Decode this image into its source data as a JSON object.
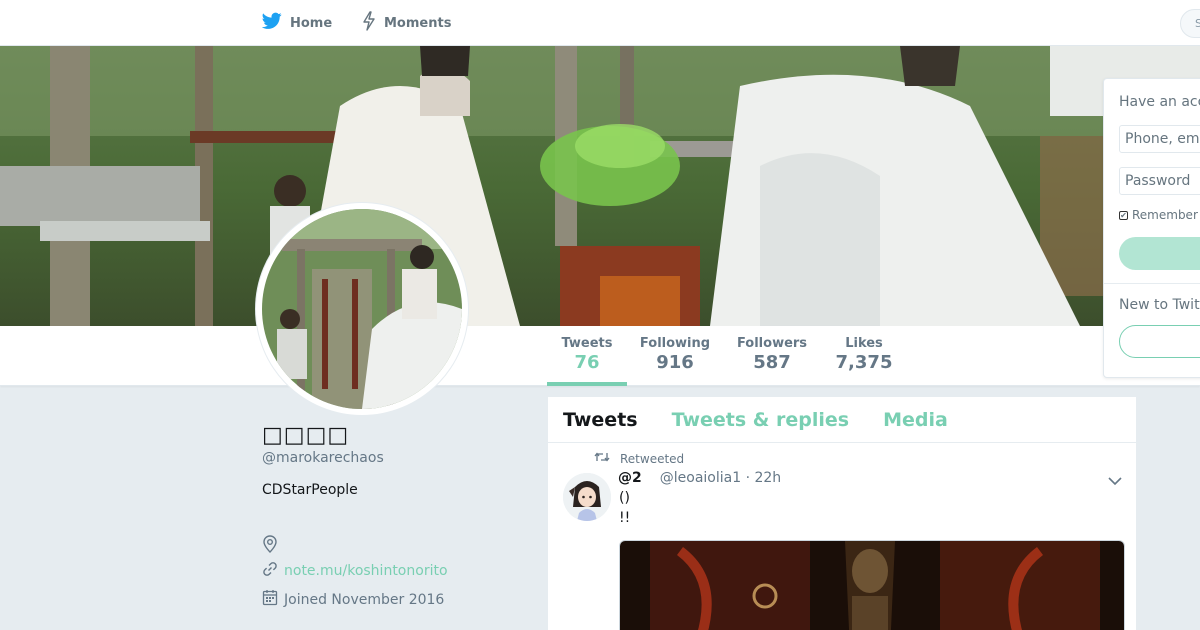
{
  "nav": {
    "home_label": "Home",
    "moments_label": "Moments",
    "search_placeholder": "S"
  },
  "profile": {
    "name": "□□□□",
    "handle": "@marokarechaos",
    "bio": "CDStarPeople",
    "link": "note.mu/koshintonorito",
    "joined": "Joined November 2016"
  },
  "stats": [
    {
      "label": "Tweets",
      "value": "76"
    },
    {
      "label": "Following",
      "value": "916"
    },
    {
      "label": "Followers",
      "value": "587"
    },
    {
      "label": "Likes",
      "value": "7,375"
    }
  ],
  "timeline": {
    "tabs": [
      "Tweets",
      "Tweets & replies",
      "Media"
    ],
    "tweet": {
      "context": "Retweeted",
      "display_name": "@2",
      "handle_time": "@leoaiolia1 · 22h",
      "line1": "()",
      "line2": "!!"
    }
  },
  "login": {
    "title": "Have an account?",
    "phone_placeholder": "Phone, email or username",
    "password_placeholder": "Password",
    "remember_label": "Remember me",
    "new_title": "New to Twitter?"
  },
  "colors": {
    "accent": "#79cfb2",
    "accent_light": "#b2e5d3",
    "page_bg": "#e6ecf0",
    "muted_text": "#657786"
  },
  "icons": {
    "logo": "bird-icon",
    "moments": "lightning-icon",
    "location": "location-pin-icon",
    "link": "link-icon",
    "calendar": "calendar-icon",
    "retweet": "retweet-icon",
    "caret": "chevron-down-icon"
  }
}
